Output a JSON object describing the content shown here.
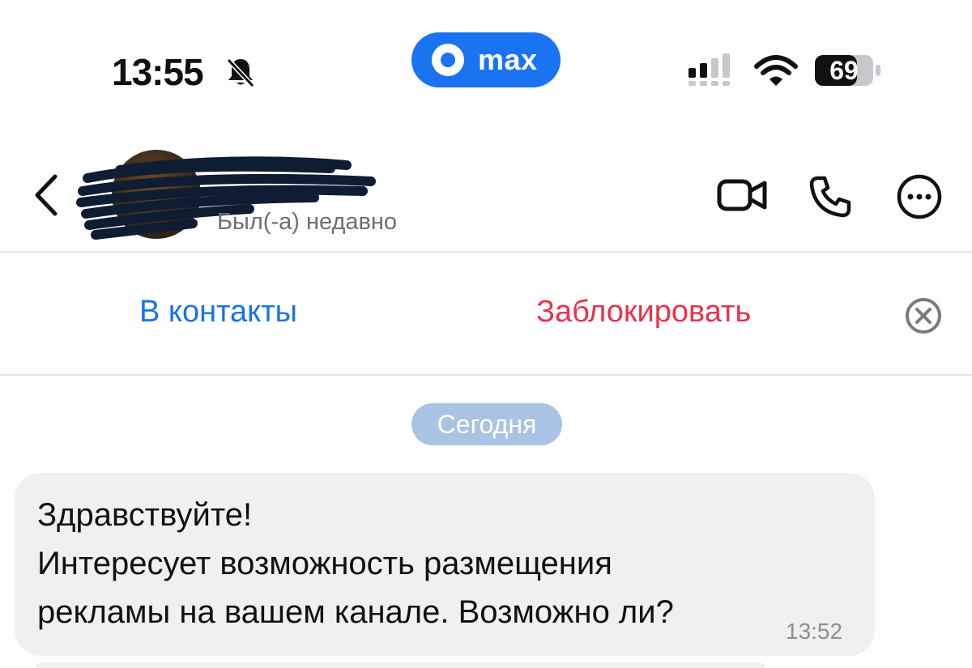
{
  "status_bar": {
    "time": "13:55",
    "app_pill_label": "max",
    "battery_level": "69",
    "icons": [
      "bell-muted-icon",
      "cellular-signal-icon",
      "wifi-icon",
      "battery-icon"
    ]
  },
  "header": {
    "contact_status": "Был(-а) недавно",
    "icons": [
      "back-icon",
      "video-call-icon",
      "phone-call-icon",
      "more-icon"
    ]
  },
  "actions": {
    "add_contact": "В контакты",
    "block": "Заблокировать"
  },
  "chat": {
    "date_separator": "Сегодня",
    "messages": [
      {
        "lines": [
          "Здравствуйте!",
          "Интересует возможность размещения",
          "рекламы на вашем канале. Возможно ли?"
        ],
        "time": "13:52"
      }
    ]
  },
  "colors": {
    "accent_blue": "#1a73e8",
    "danger_red": "#e8334a",
    "pill_blue": "#1a73f0",
    "date_pill": "#a8c3e4",
    "bubble_bg": "#f0f0f2"
  }
}
